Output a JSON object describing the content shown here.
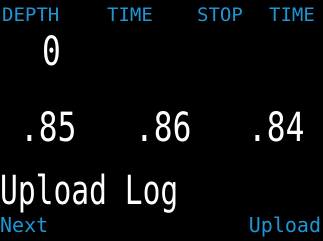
{
  "header": {
    "depth_label": "DEPTH",
    "time_label": "TIME",
    "stop_label": "STOP",
    "stop_time_label": "TIME"
  },
  "main": {
    "depth_value": "0",
    "readings": [
      ".85",
      ".86",
      ".84"
    ],
    "message": "Upload Log"
  },
  "softkeys": {
    "left_label": "Next",
    "right_label": "Upload"
  },
  "colors": {
    "accent": "#1e96d6",
    "text": "#ffffff",
    "background": "#000000"
  }
}
